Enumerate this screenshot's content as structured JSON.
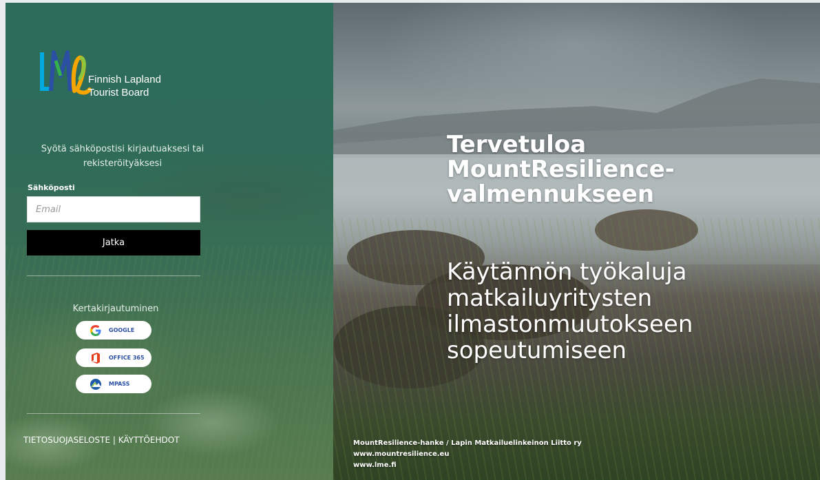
{
  "brand": {
    "logo_letters": "LME",
    "name_line1": "Finnish Lapland",
    "name_line2": "Tourist Board"
  },
  "login": {
    "intro_text": "Syötä sähköpostisi kirjautuaksesi tai rekisteröityäksesi",
    "email_label": "Sähköposti",
    "email_placeholder": "Email",
    "email_value": "",
    "continue_label": "Jatka"
  },
  "sso": {
    "title": "Kertakirjautuminen",
    "providers": [
      {
        "label": "GOOGLE",
        "icon": "google-icon"
      },
      {
        "label": "OFFICE 365",
        "icon": "office-365-icon"
      },
      {
        "label": "MPASS",
        "icon": "mpass-icon"
      }
    ]
  },
  "footer": {
    "privacy_label": "TIETOSUOJASELOSTE",
    "separator": "|",
    "terms_label": "KÄYTTÖEHDOT"
  },
  "hero": {
    "welcome_line1": "Tervetuloa",
    "welcome_line2": "MountResilience-",
    "welcome_line3": "valmennukseen",
    "subtitle_line1": "Käytännön työkaluja",
    "subtitle_line2": "matkailuyritysten",
    "subtitle_line3": "ilmastonmuutokseen",
    "subtitle_line4": "sopeutumiseen"
  },
  "credits": {
    "line1": "MountResilience-hanke / Lapin Matkailuelinkeinon Liitto ry",
    "line2": "www.mountresilience.eu",
    "line3": "www.lme.fi"
  },
  "colors": {
    "panel_green": "#2f6b59",
    "button_black": "#000000",
    "office_red": "#e43e1c",
    "mpass_blue": "#1e5aa8"
  }
}
